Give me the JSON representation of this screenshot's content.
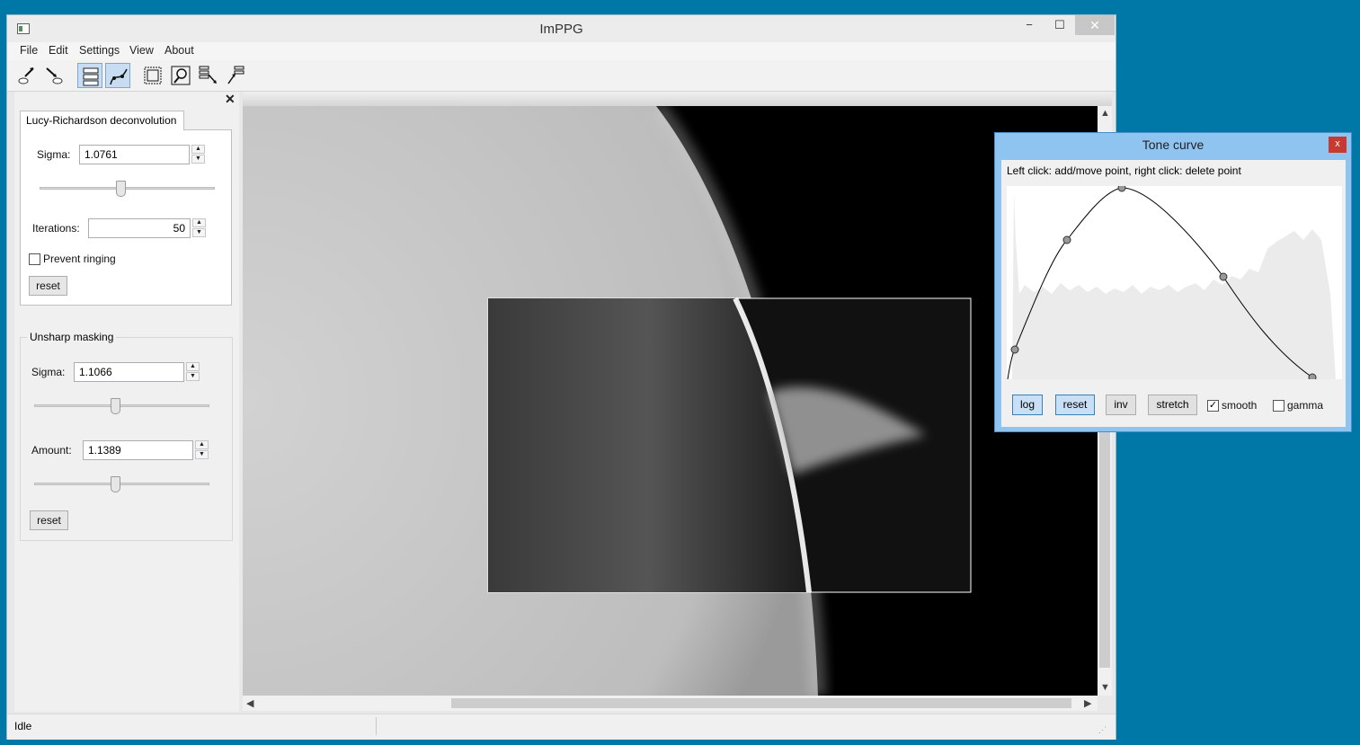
{
  "window": {
    "title": "ImPPG",
    "minimize": "−",
    "maximize": "☐",
    "close": "✕"
  },
  "menu": [
    "File",
    "Edit",
    "Settings",
    "View",
    "About"
  ],
  "toolbar": {
    "icons": [
      "open-file-icon",
      "save-file-icon",
      "processing-settings-icon",
      "tone-curve-icon",
      "select-all-icon",
      "fit-window-icon",
      "batch-processing-icon",
      "align-images-icon"
    ],
    "active": [
      "processing-settings-icon",
      "tone-curve-icon"
    ]
  },
  "left_panel": {
    "close": "✕",
    "lucy_richardson": {
      "title": "Lucy-Richardson deconvolution",
      "sigma_label": "Sigma:",
      "sigma_value": "1.0761",
      "iterations_label": "Iterations:",
      "iterations_value": "50",
      "prevent_ringing_label": "Prevent ringing",
      "prevent_ringing_checked": false,
      "reset_label": "reset",
      "sigma_slider_level": 0.46
    },
    "unsharp_masking": {
      "title": "Unsharp masking",
      "sigma_label": "Sigma:",
      "sigma_value": "1.1066",
      "amount_label": "Amount:",
      "amount_value": "1.1389",
      "reset_label": "reset",
      "sigma_slider_level": 0.46,
      "amount_slider_level": 0.46
    }
  },
  "status": {
    "text": "Idle"
  },
  "scroll": {
    "up": "▲",
    "down": "▼",
    "left": "◀",
    "right": "▶"
  },
  "tone_curve": {
    "title": "Tone curve",
    "close": "x",
    "hint": "Left click: add/move point, right click: delete point",
    "buttons": {
      "log": "log",
      "reset": "reset",
      "inv": "inv",
      "stretch": "stretch"
    },
    "log_active": true,
    "smooth_label": "smooth",
    "smooth_checked": true,
    "gamma_label": "gamma",
    "gamma_checked": false
  },
  "colors": {
    "desktop": "#0078a7",
    "accent": "#3c7fb1",
    "tone_frame": "#8fc3f0",
    "close_red": "#c73a31"
  }
}
